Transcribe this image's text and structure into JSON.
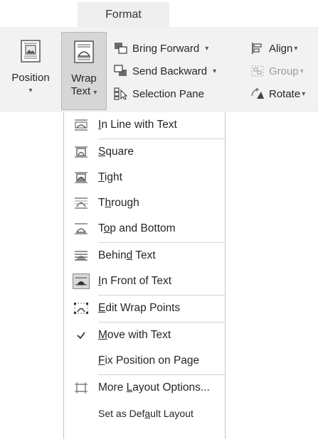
{
  "ribbon": {
    "tab_label": "Format",
    "position_label": "Position",
    "wrap_label_1": "Wrap",
    "wrap_label_2": "Text",
    "bring_forward": "Bring Forward",
    "send_backward": "Send Backward",
    "selection_pane": "Selection Pane",
    "align": "Align",
    "group": "Group",
    "rotate": "Rotate",
    "dropdown_caret": "▾"
  },
  "menu": {
    "items": [
      {
        "pre": "",
        "key": "I",
        "post": "n Line with Text",
        "icon": "inline-icon"
      },
      {
        "pre": "",
        "key": "S",
        "post": "quare",
        "icon": "square-wrap-icon"
      },
      {
        "pre": "",
        "key": "T",
        "post": "ight",
        "icon": "tight-wrap-icon"
      },
      {
        "pre": "T",
        "key": "h",
        "post": "rough",
        "icon": "through-wrap-icon"
      },
      {
        "pre": "T",
        "key": "o",
        "post": "p and Bottom",
        "icon": "top-bottom-wrap-icon"
      },
      {
        "pre": "Behin",
        "key": "d",
        "post": " Text",
        "icon": "behind-text-icon"
      },
      {
        "pre": "",
        "key": "I",
        "post": "n Front of Text",
        "icon": "in-front-text-icon"
      },
      {
        "pre": "",
        "key": "E",
        "post": "dit Wrap Points",
        "icon": "edit-wrap-points-icon"
      },
      {
        "pre": "",
        "key": "M",
        "post": "ove with Text",
        "icon": "checkmark-icon"
      },
      {
        "pre": "",
        "key": "F",
        "post": "ix Position on Page",
        "icon": ""
      },
      {
        "pre": "More ",
        "key": "L",
        "post": "ayout Options...",
        "icon": "layout-options-icon"
      },
      {
        "pre": "Set as Def",
        "key": "a",
        "post": "ult Layout",
        "icon": ""
      }
    ]
  }
}
